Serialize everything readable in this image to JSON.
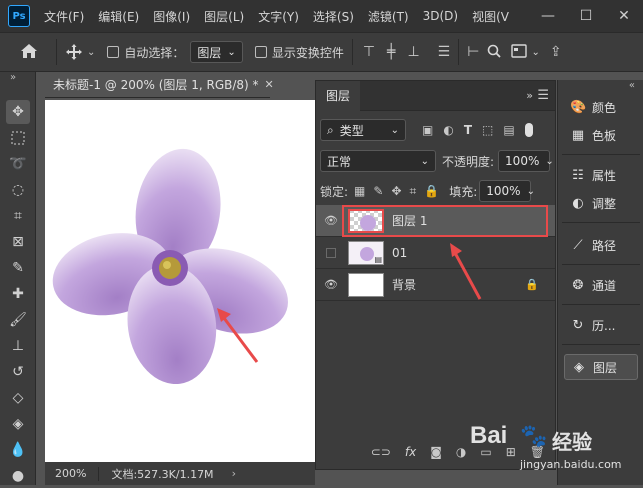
{
  "app": {
    "logo_text": "Ps",
    "brand_color": "#31a8ff",
    "accent_highlight": "#e84a4a"
  },
  "menu": [
    "文件(F)",
    "编辑(E)",
    "图像(I)",
    "图层(L)",
    "文字(Y)",
    "选择(S)",
    "滤镜(T)",
    "3D(D)",
    "视图(V"
  ],
  "window_controls": {
    "minimize": "—",
    "maximize": "☐",
    "close": "✕"
  },
  "options_bar": {
    "auto_select_label": "自动选择：",
    "auto_select_value": "图层",
    "show_transform_label": "显示变换控件"
  },
  "document": {
    "tab_title": "未标题-1 @ 200% (图层 1, RGB/8) *",
    "zoom": "200%",
    "doc_info": "文档:527.3K/1.17M"
  },
  "layers_panel": {
    "tab_label": "图层",
    "filter_kind": "类型",
    "blend_mode": "正常",
    "opacity_label": "不透明度:",
    "opacity_value": "100%",
    "lock_label": "锁定:",
    "fill_label": "填充:",
    "fill_value": "100%",
    "layers": [
      {
        "name": "图层 1",
        "visible": true,
        "selected": true
      },
      {
        "name": "01",
        "visible": false,
        "selected": false
      },
      {
        "name": "背景",
        "visible": true,
        "selected": false,
        "locked": true
      }
    ],
    "footer_icons": [
      "link-icon",
      "fx-icon",
      "mask-icon",
      "adjustment-icon",
      "group-icon",
      "new-layer-icon",
      "trash-icon"
    ]
  },
  "dock": {
    "items": [
      {
        "label": "颜色",
        "icon": "color-icon"
      },
      {
        "label": "色板",
        "icon": "swatches-icon"
      },
      {
        "label": "属性",
        "icon": "properties-icon"
      },
      {
        "label": "调整",
        "icon": "adjustments-icon"
      },
      {
        "label": "路径",
        "icon": "paths-icon"
      },
      {
        "label": "通道",
        "icon": "channels-icon"
      },
      {
        "label": "历...",
        "icon": "history-icon"
      },
      {
        "label": "图层",
        "icon": "layers-icon"
      }
    ]
  },
  "watermark": {
    "brand": "Bai",
    "brand_suffix": "经验",
    "url": "jingyan.baidu.com"
  }
}
